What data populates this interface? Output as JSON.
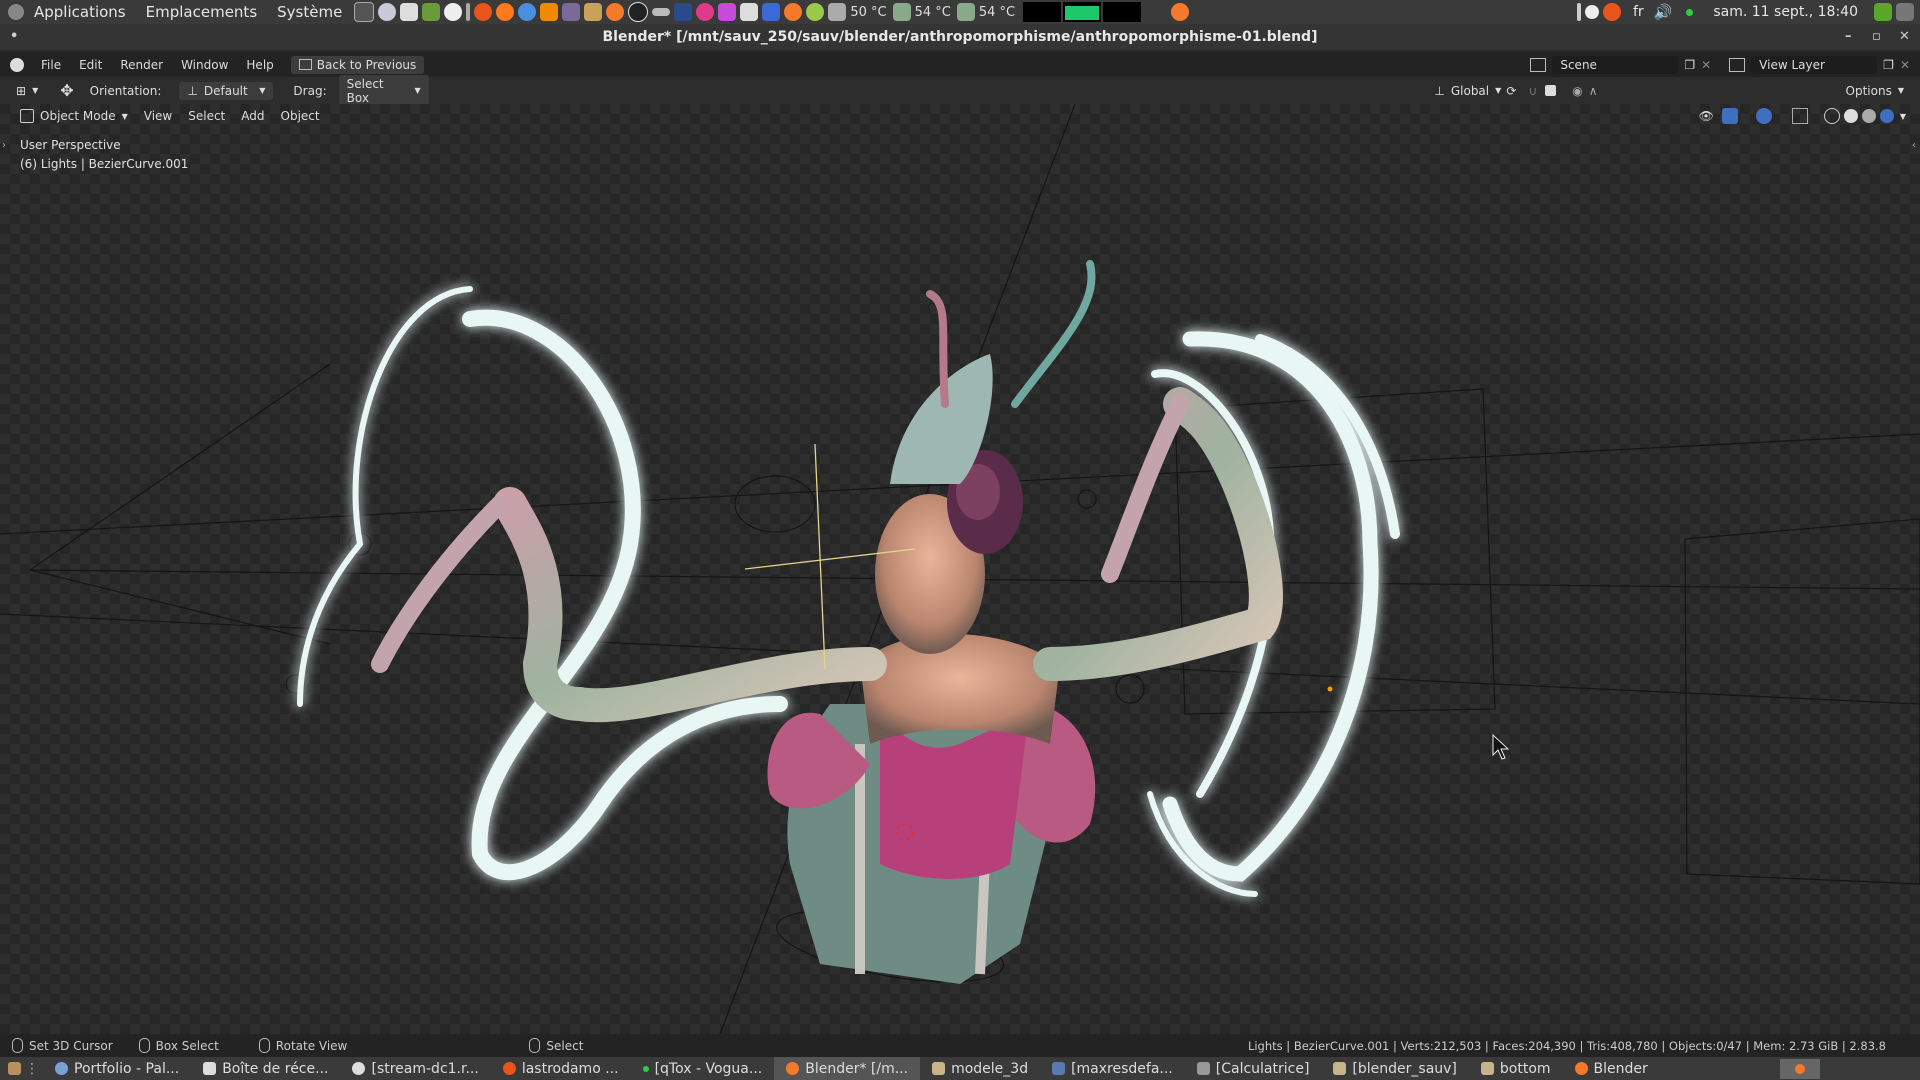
{
  "system_panel": {
    "menus": [
      "Applications",
      "Emplacements",
      "Système"
    ],
    "temps": [
      "50 °C",
      "54 °C",
      "54 °C"
    ],
    "keyboard_layout": "fr",
    "datetime": "sam. 11 sept., 18:40"
  },
  "window": {
    "title": "Blender* [/mnt/sauv_250/sauv/blender/anthropomorphisme/anthropomorphisme-01.blend]"
  },
  "blender_menu": {
    "items": [
      "File",
      "Edit",
      "Render",
      "Window",
      "Help"
    ],
    "back_button": "Back to Previous",
    "scene": "Scene",
    "view_layer": "View Layer"
  },
  "tool_header": {
    "orientation_label": "Orientation:",
    "orientation_value": "Default",
    "drag_label": "Drag:",
    "drag_value": "Select Box",
    "transform_orientation": "Global",
    "options": "Options"
  },
  "viewport_header": {
    "mode": "Object Mode",
    "menus": [
      "View",
      "Select",
      "Add",
      "Object"
    ]
  },
  "viewport": {
    "perspective": "User Perspective",
    "active_object": "(6) Lights | BezierCurve.001"
  },
  "status_bar": {
    "hints": [
      "Set 3D Cursor",
      "Box Select",
      "Rotate View",
      "Select"
    ],
    "stats": "Lights | BezierCurve.001 | Verts:212,503 | Faces:204,390 | Tris:408,780 | Objects:0/47 | Mem: 2.73 GiB | 2.83.8"
  },
  "taskbar": {
    "tasks": [
      "Portfolio - Pal...",
      "Boîte de réce...",
      "[stream-dc1.r...",
      "lastrodamo ...",
      "[qTox - Vogua...",
      "Blender* [/m...",
      "modele_3d",
      "[maxresdefa...",
      "[Calculatrice]",
      "[blender_sauv]",
      "bottom",
      "Blender"
    ],
    "active_index": 5
  }
}
